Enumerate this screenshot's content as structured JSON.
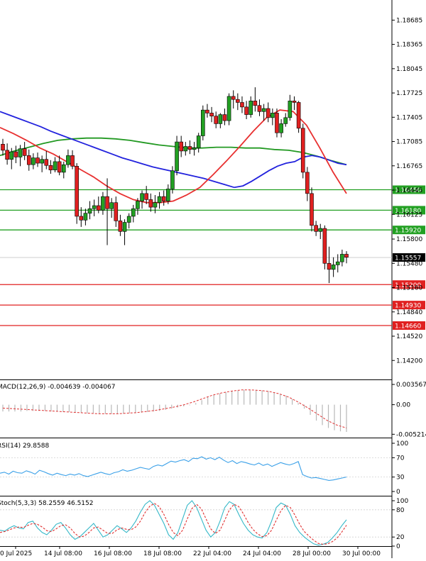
{
  "chart_data": [
    {
      "type": "candlestick",
      "symbol_note": "",
      "y_ticks": [
        "1.18685",
        "1.18365",
        "1.18045",
        "1.17725",
        "1.17405",
        "1.17085",
        "1.16765",
        "1.16445",
        "1.16125",
        "1.15800",
        "1.15480",
        "1.15160",
        "1.14840",
        "1.14520",
        "1.14200"
      ],
      "ylim": [
        1.1395,
        1.1895
      ],
      "current_price": "1.15557",
      "levels": [
        {
          "label": "1.16450",
          "value": 1.1645,
          "color": "#22a022"
        },
        {
          "label": "1.16180",
          "value": 1.1618,
          "color": "#22a022"
        },
        {
          "label": "1.15920",
          "value": 1.1592,
          "color": "#22a022"
        },
        {
          "label": "1.15200",
          "value": 1.152,
          "color": "#e02020"
        },
        {
          "label": "1.14930",
          "value": 1.1493,
          "color": "#e02020"
        },
        {
          "label": "1.14660",
          "value": 1.1466,
          "color": "#e02020"
        }
      ],
      "candles": [
        [
          1.1705,
          1.1712,
          1.169,
          1.1697
        ],
        [
          1.1697,
          1.1706,
          1.1678,
          1.1685
        ],
        [
          1.1685,
          1.17,
          1.1672,
          1.1695
        ],
        [
          1.1695,
          1.1703,
          1.168,
          1.1688
        ],
        [
          1.1688,
          1.1704,
          1.1676,
          1.1699
        ],
        [
          1.1699,
          1.1708,
          1.1684,
          1.169
        ],
        [
          1.169,
          1.1698,
          1.167,
          1.1678
        ],
        [
          1.1678,
          1.1693,
          1.1672,
          1.1687
        ],
        [
          1.1687,
          1.1694,
          1.1675,
          1.168
        ],
        [
          1.168,
          1.169,
          1.1668,
          1.1685
        ],
        [
          1.1685,
          1.1696,
          1.1672,
          1.1677
        ],
        [
          1.1677,
          1.1684,
          1.1666,
          1.1671
        ],
        [
          1.1671,
          1.1688,
          1.1668,
          1.1682
        ],
        [
          1.1682,
          1.169,
          1.1664,
          1.1668
        ],
        [
          1.1668,
          1.1682,
          1.166,
          1.1678
        ],
        [
          1.1678,
          1.1698,
          1.1674,
          1.169
        ],
        [
          1.169,
          1.1697,
          1.1672,
          1.1676
        ],
        [
          1.1676,
          1.168,
          1.16,
          1.161
        ],
        [
          1.161,
          1.1622,
          1.1596,
          1.1605
        ],
        [
          1.1605,
          1.162,
          1.1598,
          1.1614
        ],
        [
          1.1614,
          1.163,
          1.1606,
          1.162
        ],
        [
          1.162,
          1.1632,
          1.161,
          1.1624
        ],
        [
          1.1624,
          1.1636,
          1.1614,
          1.1618
        ],
        [
          1.1618,
          1.1642,
          1.1612,
          1.1636
        ],
        [
          1.1636,
          1.166,
          1.1572,
          1.162
        ],
        [
          1.162,
          1.1634,
          1.1608,
          1.1628
        ],
        [
          1.1628,
          1.1636,
          1.1596,
          1.1604
        ],
        [
          1.1604,
          1.1612,
          1.1584,
          1.159
        ],
        [
          1.159,
          1.1606,
          1.1572,
          1.1602
        ],
        [
          1.1602,
          1.1614,
          1.1594,
          1.161
        ],
        [
          1.161,
          1.1625,
          1.1602,
          1.162
        ],
        [
          1.162,
          1.1634,
          1.1612,
          1.163
        ],
        [
          1.163,
          1.1644,
          1.162,
          1.164
        ],
        [
          1.164,
          1.165,
          1.1626,
          1.1632
        ],
        [
          1.1632,
          1.164,
          1.1616,
          1.1622
        ],
        [
          1.1622,
          1.1638,
          1.1614,
          1.1628
        ],
        [
          1.1628,
          1.1642,
          1.162,
          1.1636
        ],
        [
          1.1636,
          1.1644,
          1.1624,
          1.163
        ],
        [
          1.163,
          1.1652,
          1.1626,
          1.1646
        ],
        [
          1.1646,
          1.1676,
          1.164,
          1.167
        ],
        [
          1.167,
          1.1716,
          1.1664,
          1.1708
        ],
        [
          1.1708,
          1.1716,
          1.1688,
          1.1696
        ],
        [
          1.1696,
          1.1708,
          1.169,
          1.1702
        ],
        [
          1.1702,
          1.171,
          1.1692,
          1.1698
        ],
        [
          1.1698,
          1.1708,
          1.169,
          1.17
        ],
        [
          1.17,
          1.172,
          1.1694,
          1.1716
        ],
        [
          1.1716,
          1.1756,
          1.171,
          1.175
        ],
        [
          1.175,
          1.1758,
          1.174,
          1.1746
        ],
        [
          1.1746,
          1.1754,
          1.1734,
          1.1742
        ],
        [
          1.1742,
          1.1748,
          1.1726,
          1.1732
        ],
        [
          1.1732,
          1.1746,
          1.1726,
          1.1744
        ],
        [
          1.1744,
          1.1752,
          1.173,
          1.1736
        ],
        [
          1.1736,
          1.1772,
          1.173,
          1.1768
        ],
        [
          1.1768,
          1.1776,
          1.1752,
          1.1764
        ],
        [
          1.1764,
          1.1772,
          1.175,
          1.176
        ],
        [
          1.176,
          1.1768,
          1.1746,
          1.1754
        ],
        [
          1.1754,
          1.1762,
          1.1738,
          1.1744
        ],
        [
          1.1744,
          1.1768,
          1.174,
          1.1762
        ],
        [
          1.1762,
          1.178,
          1.1748,
          1.1756
        ],
        [
          1.1756,
          1.1764,
          1.1742,
          1.1748
        ],
        [
          1.1748,
          1.1758,
          1.1736,
          1.1752
        ],
        [
          1.1752,
          1.176,
          1.1734,
          1.174
        ],
        [
          1.174,
          1.1752,
          1.173,
          1.1746
        ],
        [
          1.1746,
          1.1752,
          1.1714,
          1.172
        ],
        [
          1.172,
          1.1738,
          1.1714,
          1.1732
        ],
        [
          1.1732,
          1.1746,
          1.1728,
          1.174
        ],
        [
          1.174,
          1.177,
          1.1736,
          1.1762
        ],
        [
          1.1762,
          1.1768,
          1.175,
          1.176
        ],
        [
          1.176,
          1.1762,
          1.172,
          1.1726
        ],
        [
          1.1726,
          1.1732,
          1.166,
          1.1668
        ],
        [
          1.1668,
          1.1675,
          1.163,
          1.164
        ],
        [
          1.164,
          1.1648,
          1.159,
          1.1598
        ],
        [
          1.1598,
          1.1604,
          1.1584,
          1.159
        ],
        [
          1.159,
          1.16,
          1.158,
          1.1594
        ],
        [
          1.1594,
          1.1598,
          1.154,
          1.1548
        ],
        [
          1.1548,
          1.157,
          1.1522,
          1.154
        ],
        [
          1.154,
          1.1556,
          1.153,
          1.1546
        ],
        [
          1.1546,
          1.156,
          1.1536,
          1.155
        ],
        [
          1.155,
          1.1566,
          1.1544,
          1.156
        ],
        [
          1.156,
          1.1564,
          1.1548,
          1.1556
        ]
      ],
      "ma_blue": [
        1.1748,
        1.1743,
        1.1738,
        1.1733,
        1.1728,
        1.1722,
        1.1717,
        1.1712,
        1.1707,
        1.1702,
        1.1697,
        1.1692,
        1.1687,
        1.1683,
        1.1679,
        1.1675,
        1.1672,
        1.1669,
        1.1666,
        1.1663,
        1.166,
        1.1656,
        1.1652,
        1.1648
      ],
      "ma_green": [
        1.169,
        1.1696,
        1.1701,
        1.1706,
        1.171,
        1.1712,
        1.1713,
        1.1713,
        1.1712,
        1.171,
        1.1707,
        1.1704,
        1.1702,
        1.17,
        1.17,
        1.1701,
        1.1701,
        1.17,
        1.17,
        1.1698,
        1.1697,
        1.1694,
        1.1689,
        1.1683,
        1.1678
      ],
      "ma_red": [
        1.1727,
        1.1719,
        1.171,
        1.17,
        1.1692,
        1.1682,
        1.1672,
        1.1662,
        1.165,
        1.164,
        1.1632,
        1.1628,
        1.1628,
        1.163,
        1.1638,
        1.1648,
        1.1665,
        1.1683,
        1.1702,
        1.1722,
        1.174,
        1.175,
        1.1748,
        1.173,
        1.17,
        1.1668,
        1.164
      ],
      "ma_blue_tail": [
        1.1648,
        1.165,
        1.1656,
        1.1663,
        1.167,
        1.1676,
        1.168,
        1.1682,
        1.1688,
        1.169,
        1.1688,
        1.1684,
        1.168,
        1.1678
      ]
    },
    {
      "type": "bar",
      "label": "MACD(12,26,9) -0.004639 -0.004067",
      "y_ticks": [
        "0.003567",
        "0.00",
        "-0.005214"
      ],
      "ylim": [
        -0.0058,
        0.0042
      ],
      "hist": [
        -0.0012,
        -0.0012,
        -0.0012,
        -0.0012,
        -0.0011,
        -0.0011,
        -0.0011,
        -0.0011,
        -0.0012,
        -0.0012,
        -0.0013,
        -0.0013,
        -0.0014,
        -0.0014,
        -0.0015,
        -0.0015,
        -0.0016,
        -0.0016,
        -0.0016,
        -0.0016,
        -0.0016,
        -0.0015,
        -0.0015,
        -0.0014,
        -0.0013,
        -0.0012,
        -0.0011,
        -0.0009,
        -0.0007,
        -0.0005,
        -0.0003,
        -0.0001,
        0.0003,
        0.0008,
        0.0013,
        0.0017,
        0.002,
        0.0022,
        0.0024,
        0.0025,
        0.0026,
        0.0026,
        0.0026,
        0.0025,
        0.0024,
        0.0022,
        0.0019,
        0.0016,
        0.001,
        0.0003,
        -0.0007,
        -0.0018,
        -0.0028,
        -0.0036,
        -0.0041,
        -0.0045,
        -0.0047,
        -0.0048
      ],
      "signal": [
        -0.0006,
        -0.0007,
        -0.0008,
        -0.0009,
        -0.001,
        -0.0011,
        -0.0012,
        -0.0013,
        -0.0014,
        -0.0015,
        -0.0016,
        -0.0016,
        -0.0016,
        -0.0015,
        -0.0014,
        -0.0012,
        -0.001,
        -0.0007,
        -0.0004,
        0.0,
        0.0005,
        0.0011,
        0.0017,
        0.0021,
        0.0024,
        0.0026,
        0.0026,
        0.0025,
        0.0023,
        0.0019,
        0.0013,
        0.0004,
        -0.0006,
        -0.0017,
        -0.0028,
        -0.0036,
        -0.0041
      ]
    },
    {
      "type": "line",
      "label": "RSI(14) 29.8588",
      "y_ticks": [
        "100",
        "70",
        "30",
        "0"
      ],
      "ylim": [
        0,
        100
      ],
      "values": [
        38,
        40,
        36,
        42,
        39,
        38,
        43,
        40,
        36,
        44,
        41,
        37,
        34,
        38,
        35,
        33,
        36,
        34,
        37,
        33,
        31,
        34,
        37,
        40,
        37,
        35,
        39,
        41,
        45,
        42,
        44,
        47,
        50,
        48,
        46,
        52,
        55,
        53,
        58,
        63,
        61,
        64,
        66,
        62,
        69,
        68,
        72,
        67,
        70,
        66,
        71,
        65,
        60,
        64,
        58,
        62,
        60,
        57,
        55,
        59,
        54,
        57,
        52,
        56,
        60,
        57,
        55,
        58,
        62,
        35,
        31,
        28,
        29,
        27,
        25,
        23,
        24,
        26,
        28,
        30
      ]
    },
    {
      "type": "line",
      "label": "Stoch(5,3,3) 58.2559 46.5152",
      "y_ticks": [
        "100",
        "80",
        "20",
        "0"
      ],
      "ylim": [
        0,
        100
      ],
      "k": [
        35,
        33,
        40,
        45,
        40,
        38,
        52,
        55,
        40,
        30,
        25,
        35,
        48,
        52,
        40,
        25,
        15,
        20,
        30,
        40,
        50,
        35,
        20,
        25,
        35,
        45,
        38,
        30,
        40,
        55,
        75,
        92,
        100,
        90,
        70,
        50,
        25,
        15,
        30,
        60,
        90,
        100,
        85,
        60,
        35,
        20,
        30,
        55,
        85,
        98,
        92,
        70,
        50,
        35,
        25,
        20,
        18,
        30,
        55,
        85,
        95,
        90,
        70,
        45,
        30,
        20,
        12,
        5,
        2,
        4,
        8,
        18,
        30,
        45,
        58
      ],
      "d": [
        30,
        32,
        36,
        40,
        42,
        41,
        46,
        50,
        48,
        42,
        34,
        32,
        38,
        45,
        47,
        40,
        28,
        20,
        22,
        30,
        40,
        42,
        35,
        28,
        28,
        36,
        40,
        37,
        36,
        42,
        55,
        74,
        88,
        94,
        87,
        70,
        48,
        30,
        23,
        35,
        60,
        83,
        92,
        82,
        60,
        38,
        28,
        35,
        57,
        80,
        92,
        87,
        71,
        52,
        37,
        27,
        21,
        23,
        35,
        57,
        78,
        90,
        85,
        68,
        48,
        32,
        22,
        13,
        6,
        4,
        5,
        10,
        18,
        31,
        46
      ]
    }
  ],
  "x_axis": {
    "labels": [
      "0 Jul 2025",
      "14 Jul 08:00",
      "16 Jul 08:00",
      "18 Jul 08:00",
      "22 Jul 04:00",
      "24 Jul 04:00",
      "28 Jul 00:00",
      "30 Jul 00:00"
    ]
  },
  "colors": {
    "up_candle": "#22a022",
    "down_candle": "#e02020",
    "ma_blue": "#2222dd",
    "ma_green": "#229922",
    "ma_red": "#e83030",
    "macd_hist": "#b8b8b8",
    "macd_signal": "#e03030",
    "rsi": "#3aa0e8",
    "stoch_k": "#35b8c8",
    "stoch_d": "#e03030",
    "price_tag_bg": "#000000"
  }
}
